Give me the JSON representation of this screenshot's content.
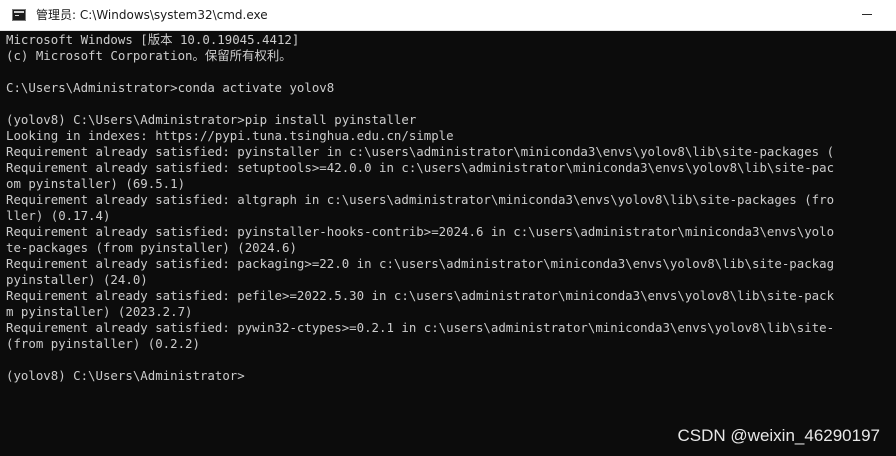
{
  "window": {
    "title": "管理员: C:\\Windows\\system32\\cmd.exe",
    "icon": "cmd-icon"
  },
  "console": {
    "lines": [
      "Microsoft Windows [版本 10.0.19045.4412]",
      "(c) Microsoft Corporation。保留所有权利。",
      "",
      "C:\\Users\\Administrator>conda activate yolov8",
      "",
      "(yolov8) C:\\Users\\Administrator>pip install pyinstaller",
      "Looking in indexes: https://pypi.tuna.tsinghua.edu.cn/simple",
      "Requirement already satisfied: pyinstaller in c:\\users\\administrator\\miniconda3\\envs\\yolov8\\lib\\site-packages (",
      "Requirement already satisfied: setuptools>=42.0.0 in c:\\users\\administrator\\miniconda3\\envs\\yolov8\\lib\\site-pac",
      "om pyinstaller) (69.5.1)",
      "Requirement already satisfied: altgraph in c:\\users\\administrator\\miniconda3\\envs\\yolov8\\lib\\site-packages (fro",
      "ller) (0.17.4)",
      "Requirement already satisfied: pyinstaller-hooks-contrib>=2024.6 in c:\\users\\administrator\\miniconda3\\envs\\yolo",
      "te-packages (from pyinstaller) (2024.6)",
      "Requirement already satisfied: packaging>=22.0 in c:\\users\\administrator\\miniconda3\\envs\\yolov8\\lib\\site-packag",
      "pyinstaller) (24.0)",
      "Requirement already satisfied: pefile>=2022.5.30 in c:\\users\\administrator\\miniconda3\\envs\\yolov8\\lib\\site-pack",
      "m pyinstaller) (2023.2.7)",
      "Requirement already satisfied: pywin32-ctypes>=0.2.1 in c:\\users\\administrator\\miniconda3\\envs\\yolov8\\lib\\site-",
      "(from pyinstaller) (0.2.2)",
      "",
      "(yolov8) C:\\Users\\Administrator>"
    ]
  },
  "watermark": "CSDN @weixin_46290197",
  "colors": {
    "console_bg": "#0c0c0c",
    "console_text": "#cccccc",
    "titlebar_bg": "#ffffff"
  }
}
